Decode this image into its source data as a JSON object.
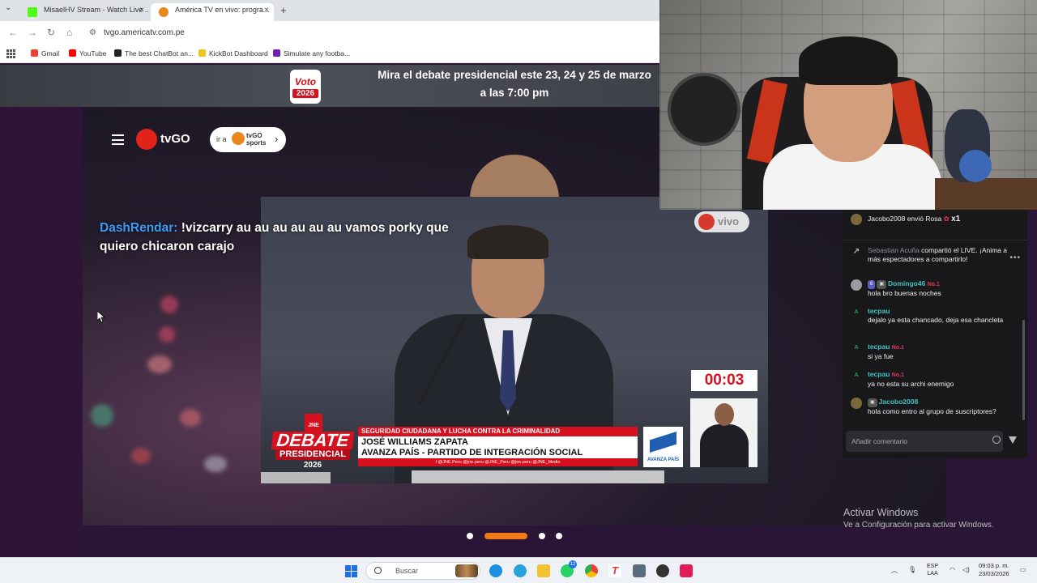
{
  "browser": {
    "tabs": [
      {
        "title": "MisaelHV Stream - Watch Live ...",
        "favicon_color": "#53fc18"
      },
      {
        "title": "América TV en vivo: progra...",
        "favicon_color": "#e8871e"
      }
    ],
    "url": "tvgo.americatv.com.pe",
    "bookmarks": [
      {
        "label": "Gmail",
        "color": "#ea4335"
      },
      {
        "label": "YouTube",
        "color": "#ff0000"
      },
      {
        "label": "The best ChatBot an...",
        "color": "#222222"
      },
      {
        "label": "KickBot Dashboard",
        "color": "#f0c419"
      },
      {
        "label": "Simulate any footba...",
        "color": "#6a1fb5"
      }
    ]
  },
  "banner": {
    "badge_line1": "Voto",
    "badge_line2": "2026",
    "text_line1_pre": "Mira el debate presidencial este ",
    "text_line1_dates": "23, 24 y 25 de marzo",
    "text_line2_pre": "a las ",
    "text_line2_time": "7:00 pm"
  },
  "site": {
    "logo_text": "tvGO",
    "sports_prefix": "ir a",
    "sports_line1": "tvGO",
    "sports_line2": "sports"
  },
  "overlay_chat": {
    "user": "DashRendar:",
    "message": " !vizcarry au au au au au au vamos porky que quiero chicaron carajo"
  },
  "video": {
    "live_label": "vivo",
    "timer": "00:03",
    "debate_jne": "JNE",
    "debate_title": "DEBATE",
    "debate_subtitle": "PRESIDENCIAL",
    "debate_year": "2026",
    "topic": "SEGURIDAD CIUDADANA Y LUCHA CONTRA LA CRIMINALIDAD",
    "candidate": "JOSÉ WILLIAMS ZAPATA",
    "party": "AVANZA PAÍS - PARTIDO DE INTEGRACIÓN SOCIAL",
    "social": "f @JNE.Peru    @jne.peru    @JNE_Peru    @jne.peru    @JNE_Medio",
    "party_logo_text": "AVANZA PAÍS"
  },
  "carousel": {
    "active_index": 1,
    "count": 4
  },
  "watermark": {
    "line1": "Activar Windows",
    "line2": "Ve a Configuración para activar Windows."
  },
  "stream_chat": {
    "gift": {
      "user": "Jacobo2008",
      "action": " envió Rosa ",
      "count": "x1"
    },
    "share": {
      "user": "Sebastian Acuña",
      "text": " compartió el LIVE. ¡Anima a más espectadores a compartirlo!"
    },
    "messages": [
      {
        "user": "Domingo46",
        "badge1": "6",
        "badge2": "No.1",
        "text": "hola bro buenas noches",
        "avatar": "",
        "avatar_color": "#9a9aa2"
      },
      {
        "user": "tecpau",
        "badge1": "",
        "badge2": "",
        "text": "dejalo ya esta chancado, deja esa chancleta",
        "avatar": "A",
        "avatar_color": "#1f9e5e"
      },
      {
        "user": "tecpau",
        "badge1": "",
        "badge2": "No.1",
        "text": "si ya fue",
        "avatar": "A",
        "avatar_color": "#1f9e5e"
      },
      {
        "user": "tecpau",
        "badge1": "",
        "badge2": "No.1",
        "text": "ya no esta su archi enemigo",
        "avatar": "A",
        "avatar_color": "#1f9e5e"
      },
      {
        "user": "Jacobo2008",
        "badge1": "",
        "badge2": "",
        "text": "hola como entro al grupo de suscriptores?",
        "avatar": "",
        "avatar_color": "#7a6a3a"
      }
    ],
    "input_placeholder": "Añadir comentario"
  },
  "taskbar": {
    "search_placeholder": "Buscar",
    "whatsapp_badge": "12",
    "lang_line1": "ESP",
    "lang_line2": "LAA",
    "time": "09:03 p. m.",
    "date": "23/03/2026"
  }
}
